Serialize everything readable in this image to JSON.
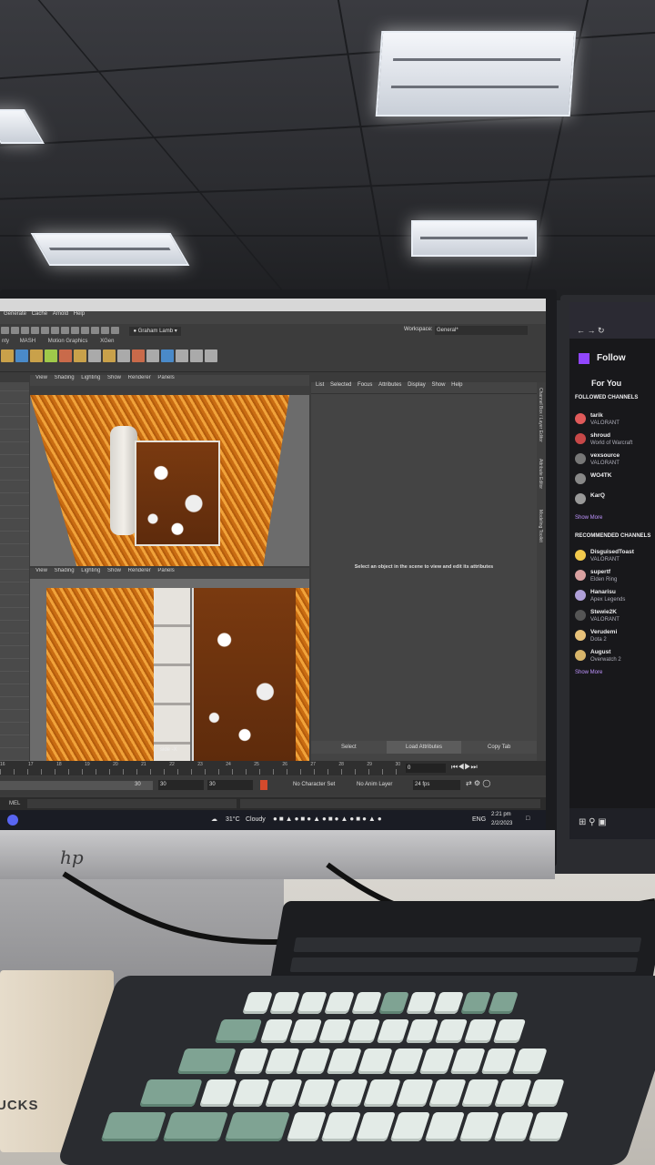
{
  "maya": {
    "menu": [
      "Generate",
      "Cache",
      "Arnold",
      "Help"
    ],
    "user": "Graham Lamb",
    "workspace_label": "Workspace:",
    "workspace_value": "General*",
    "shelf_tabs": [
      "nty",
      "MASH",
      "Motion Graphics",
      "XGen"
    ],
    "viewport_menu": [
      "View",
      "Shading",
      "Lighting",
      "Show",
      "Renderer",
      "Panels"
    ],
    "viewport_label": "side -X",
    "attr_menu": [
      "List",
      "Selected",
      "Focus",
      "Attributes",
      "Display",
      "Show",
      "Help"
    ],
    "attr_message": "Select an object in the scene to view and edit its attributes",
    "attr_buttons": [
      "Select",
      "Load Attributes",
      "Copy Tab"
    ],
    "side_tabs": [
      "Channel Box / Layer Editor",
      "Attribute Editor",
      "Modeling Toolkit"
    ],
    "timeline_ticks": [
      "16",
      "17",
      "18",
      "19",
      "20",
      "21",
      "22",
      "23",
      "24",
      "25",
      "26",
      "27",
      "28",
      "29",
      "30"
    ],
    "current_frame": "0",
    "range_start": "30",
    "range_values": [
      "30",
      "30"
    ],
    "character_set": "No Character Set",
    "anim_layer": "No Anim Layer",
    "fps": "24 fps",
    "mel_label": "MEL"
  },
  "taskbar": {
    "weather_temp": "31°C",
    "weather_text": "Cloudy",
    "language": "ENG",
    "time": "2:21 pm",
    "date": "2/2/2023"
  },
  "twitch": {
    "title": "Follow",
    "for_you": "For You",
    "followed_heading": "FOLLOWED CHANNELS",
    "followed": [
      {
        "name": "tarik",
        "game": "VALORANT"
      },
      {
        "name": "shroud",
        "game": "World of Warcraft"
      },
      {
        "name": "vexsource",
        "game": "VALORANT"
      },
      {
        "name": "WO4TK",
        "game": ""
      },
      {
        "name": "KarQ",
        "game": ""
      }
    ],
    "show_more": "Show More",
    "recommended_heading": "RECOMMENDED CHANNELS",
    "recommended": [
      {
        "name": "DisguisedToast",
        "game": "VALORANT"
      },
      {
        "name": "supertf",
        "game": "Elden Ring"
      },
      {
        "name": "Hanarisu",
        "game": "Apex Legends"
      },
      {
        "name": "Stewie2K",
        "game": "VALORANT"
      },
      {
        "name": "Verudemi",
        "game": "Dota 2"
      },
      {
        "name": "August",
        "game": "Overwatch 2"
      }
    ],
    "show_more_2": "Show More"
  },
  "brand_logo": "hp",
  "cup_text": "UCKS"
}
